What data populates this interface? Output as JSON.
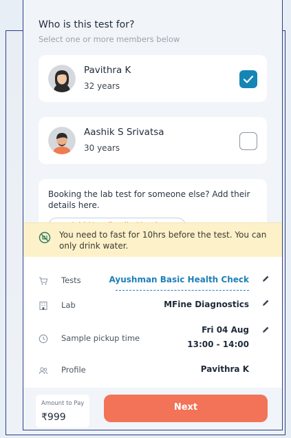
{
  "header": {
    "title": "Who is this test for?",
    "subtitle": "Select one or more members below"
  },
  "members": [
    {
      "name": "Pavithra K",
      "age": "32 years",
      "selected": true
    },
    {
      "name": "Aashik S Srivatsa",
      "age": "30 years",
      "selected": false
    }
  ],
  "add_member": {
    "text": "Booking the lab test for someone else? Add their details here.",
    "button_label": "+ Add New Family Member"
  },
  "notice": {
    "text": "You need to fast for 10hrs before the test. You can only drink water."
  },
  "details": {
    "tests_label": "Tests",
    "tests_value": "Ayushman Basic Health Check",
    "lab_label": "Lab",
    "lab_value": "MFine Diagnostics",
    "pickup_label": "Sample pickup time",
    "pickup_date": "Fri 04 Aug",
    "pickup_slot": "13:00 - 14:00",
    "profile_label": "Profile",
    "profile_value": "Pavithra K"
  },
  "footer": {
    "amount_label": "Amount to Pay",
    "amount_value": "₹999",
    "next_label": "Next"
  },
  "colors": {
    "accent": "#1585b5",
    "cta": "#f27358",
    "notice_bg": "#fdf1c9",
    "frame": "#2b3e87"
  }
}
